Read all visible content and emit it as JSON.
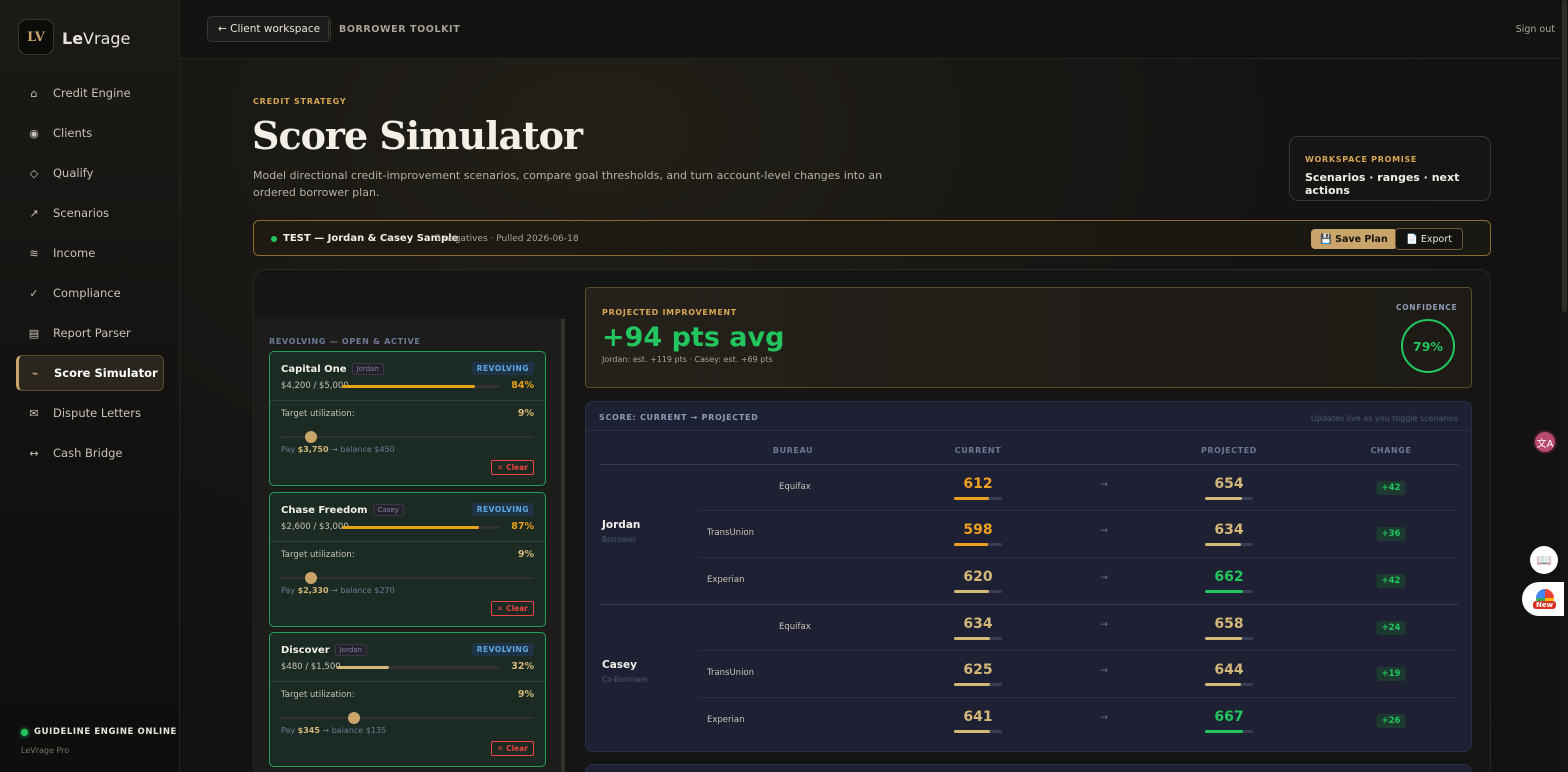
{
  "app": {
    "logo_mark": "LV",
    "logo_bold": "Le",
    "logo_light": "Vrage"
  },
  "sidebar": {
    "items": [
      {
        "icon": "home-icon",
        "glyph": "⌂",
        "label": "Credit Engine"
      },
      {
        "icon": "clients-icon",
        "glyph": "◉",
        "label": "Clients"
      },
      {
        "icon": "diamond-icon",
        "glyph": "◇",
        "label": "Qualify"
      },
      {
        "icon": "trend-arrow-icon",
        "glyph": "↗",
        "label": "Scenarios"
      },
      {
        "icon": "wave-icon",
        "glyph": "≋",
        "label": "Income"
      },
      {
        "icon": "check-icon",
        "glyph": "✓",
        "label": "Compliance"
      },
      {
        "icon": "document-icon",
        "glyph": "▤",
        "label": "Report Parser"
      },
      {
        "icon": "pulse-icon",
        "glyph": "⌁",
        "label": "Score Simulator"
      },
      {
        "icon": "envelope-icon",
        "glyph": "✉",
        "label": "Dispute Letters"
      },
      {
        "icon": "bridge-icon",
        "glyph": "↔",
        "label": "Cash Bridge"
      }
    ],
    "status": "GUIDELINE ENGINE ONLINE",
    "plan": "LeVrage Pro"
  },
  "topbar": {
    "back": "← Client workspace",
    "section": "BORROWER TOOLKIT",
    "signout": "Sign out"
  },
  "header": {
    "eyebrow": "CREDIT STRATEGY",
    "title": "Score Simulator",
    "description": "Model directional credit-improvement scenarios, compare goal thresholds, and turn account-level changes into an ordered borrower plan.",
    "promise_title": "WORKSPACE PROMISE",
    "promise_text": "Scenarios · ranges · next actions"
  },
  "client": {
    "name": "TEST — Jordan & Casey Sample",
    "meta": "5 negatives · Pulled 2026-06-18",
    "save": "💾 Save Plan",
    "export": "📄 Export"
  },
  "accounts": {
    "section_label": "REVOLVING — OPEN & ACTIVE",
    "target_label": "Target utilization:",
    "clear": "✕ Clear",
    "cards": [
      {
        "name": "Capital One",
        "owner": "Jordan",
        "type": "REVOLVING",
        "balance": "$4,200 / $5,000",
        "util": "84%",
        "util_value": 84,
        "util_color": "#e8a21a",
        "target": "9%",
        "slider": 0.12,
        "pay_prefix": "Pay ",
        "pay": "$3,750",
        "pay_suffix": " → balance $450"
      },
      {
        "name": "Chase Freedom",
        "owner": "Casey",
        "type": "REVOLVING",
        "balance": "$2,600 / $3,000",
        "util": "87%",
        "util_value": 87,
        "util_color": "#e8a21a",
        "target": "9%",
        "slider": 0.12,
        "pay_prefix": "Pay ",
        "pay": "$2,330",
        "pay_suffix": " → balance $270"
      },
      {
        "name": "Discover",
        "owner": "Jordan",
        "type": "REVOLVING",
        "balance": "$480 / $1,500",
        "util": "32%",
        "util_value": 32,
        "util_color": "#d4b87a",
        "target": "9%",
        "slider": 0.29,
        "pay_prefix": "Pay ",
        "pay": "$345",
        "pay_suffix": " → balance $135"
      }
    ]
  },
  "projection": {
    "label": "PROJECTED IMPROVEMENT",
    "value": "+94 pts avg",
    "sub": "Jordan: est. +119 pts · Casey: est. +69 pts",
    "confidence_label": "CONFIDENCE",
    "confidence": "79%"
  },
  "scores": {
    "title": "SCORE: CURRENT → PROJECTED",
    "note": "Updates live as you toggle scenarios",
    "columns": [
      "BUREAU",
      "CURRENT",
      "PROJECTED",
      "CHANGE"
    ],
    "arrow": "→",
    "people": [
      {
        "name": "Jordan",
        "role": "Borrower",
        "rows": [
          {
            "bureau": "Equifax",
            "current": "612",
            "current_color": "#f0a020",
            "current_fill": 0.72,
            "projected": "654",
            "projected_color": "#d4b87a",
            "projected_fill": 0.78,
            "change": "+42"
          },
          {
            "bureau": "TransUnion",
            "current": "598",
            "current_color": "#f0a020",
            "current_fill": 0.7,
            "projected": "634",
            "projected_color": "#d4b87a",
            "projected_fill": 0.75,
            "change": "+36"
          },
          {
            "bureau": "Experian",
            "current": "620",
            "current_color": "#d4b87a",
            "current_fill": 0.73,
            "projected": "662",
            "projected_color": "#22c55e",
            "projected_fill": 0.79,
            "change": "+42"
          }
        ]
      },
      {
        "name": "Casey",
        "role": "Co-Borrower",
        "rows": [
          {
            "bureau": "Equifax",
            "current": "634",
            "current_color": "#d4b87a",
            "current_fill": 0.75,
            "projected": "658",
            "projected_color": "#d4b87a",
            "projected_fill": 0.78,
            "change": "+24"
          },
          {
            "bureau": "TransUnion",
            "current": "625",
            "current_color": "#d4b87a",
            "current_fill": 0.74,
            "projected": "644",
            "projected_color": "#d4b87a",
            "projected_fill": 0.76,
            "change": "+19"
          },
          {
            "bureau": "Experian",
            "current": "641",
            "current_color": "#d4b87a",
            "current_fill": 0.76,
            "projected": "667",
            "projected_color": "#22c55e",
            "projected_fill": 0.8,
            "change": "+26"
          }
        ]
      }
    ]
  },
  "widgets": {
    "translate": "文A",
    "book": "📖",
    "new_badge": "New"
  }
}
